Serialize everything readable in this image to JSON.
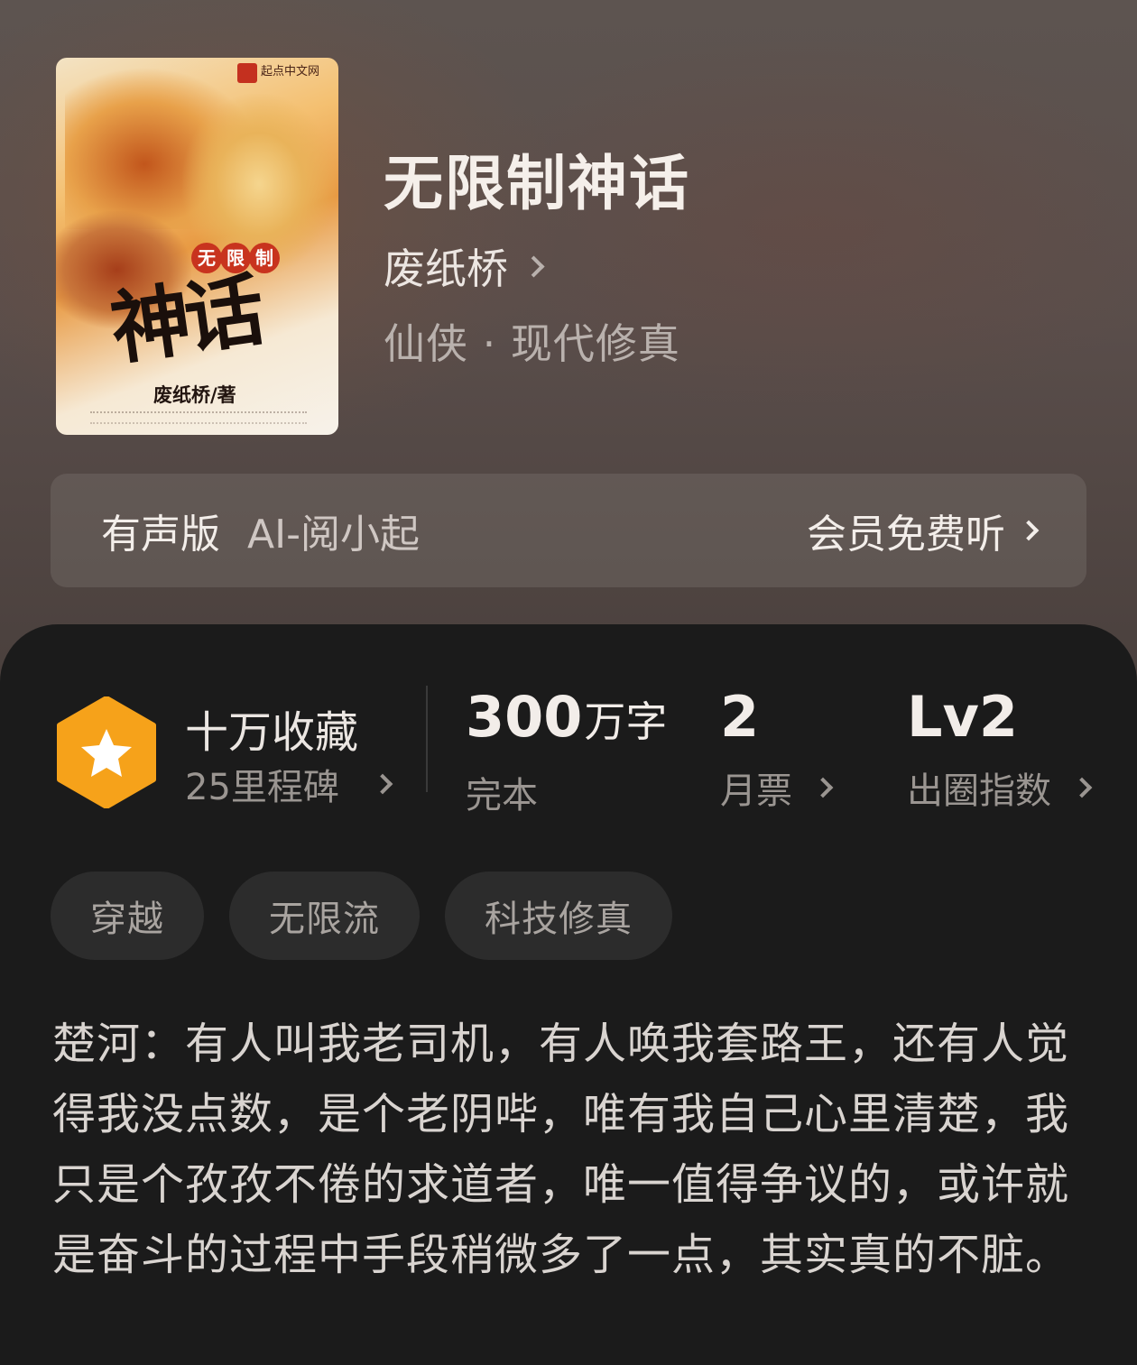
{
  "book": {
    "title": "无限制神话",
    "author": "废纸桥",
    "genre": "仙侠 · 现代修真",
    "cover": {
      "publisher": "起点中文网",
      "title_small": [
        "无",
        "限",
        "制"
      ],
      "title_big": "神话",
      "author_line": "废纸桥/著"
    }
  },
  "audio": {
    "label": "有声版",
    "voice": "AI-阅小起",
    "cta": "会员免费听"
  },
  "stats": {
    "collection": {
      "title": "十万收藏",
      "milestone": "25里程碑"
    },
    "words": {
      "value": "300",
      "unit": "万字",
      "label": "完本"
    },
    "monthly_votes": {
      "value": "2",
      "label": "月票"
    },
    "breakout": {
      "value": "Lv2",
      "label": "出圈指数"
    }
  },
  "tags": [
    "穿越",
    "无限流",
    "科技修真"
  ],
  "description": "楚河：有人叫我老司机，有人唤我套路王，还有人觉得我没点数，是个老阴哔，唯有我自己心里清楚，我只是个孜孜不倦的求道者，唯一值得争议的，或许就是奋斗的过程中手段稍微多了一点，其实真的不脏。",
  "colors": {
    "badge": "#f6a21a",
    "panel": "#1b1b1b"
  }
}
